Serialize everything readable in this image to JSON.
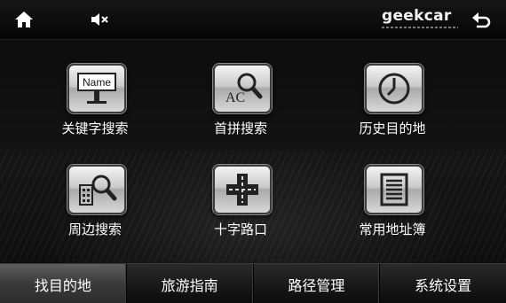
{
  "brand": {
    "name": "geekcar"
  },
  "topbar": {
    "home_icon": "home-icon",
    "mute_icon": "volume-mute-icon",
    "back_icon": "back-arrow-icon"
  },
  "grid": {
    "items": [
      {
        "label": "关键字搜索",
        "icon": "name-sign-icon",
        "icon_text": "Name"
      },
      {
        "label": "首拼搜索",
        "icon": "abc-magnifier-icon",
        "icon_text": "AC"
      },
      {
        "label": "历史目的地",
        "icon": "clock-icon"
      },
      {
        "label": "周边搜索",
        "icon": "building-magnifier-icon"
      },
      {
        "label": "十字路口",
        "icon": "crossroad-icon"
      },
      {
        "label": "常用地址簿",
        "icon": "address-book-icon"
      }
    ]
  },
  "tabs": [
    {
      "label": "找目的地",
      "active": true
    },
    {
      "label": "旅游指南",
      "active": false
    },
    {
      "label": "路径管理",
      "active": false
    },
    {
      "label": "系统设置",
      "active": false
    }
  ],
  "colors": {
    "accent": "#ffffff",
    "tab_active": "#4a4a4a"
  }
}
